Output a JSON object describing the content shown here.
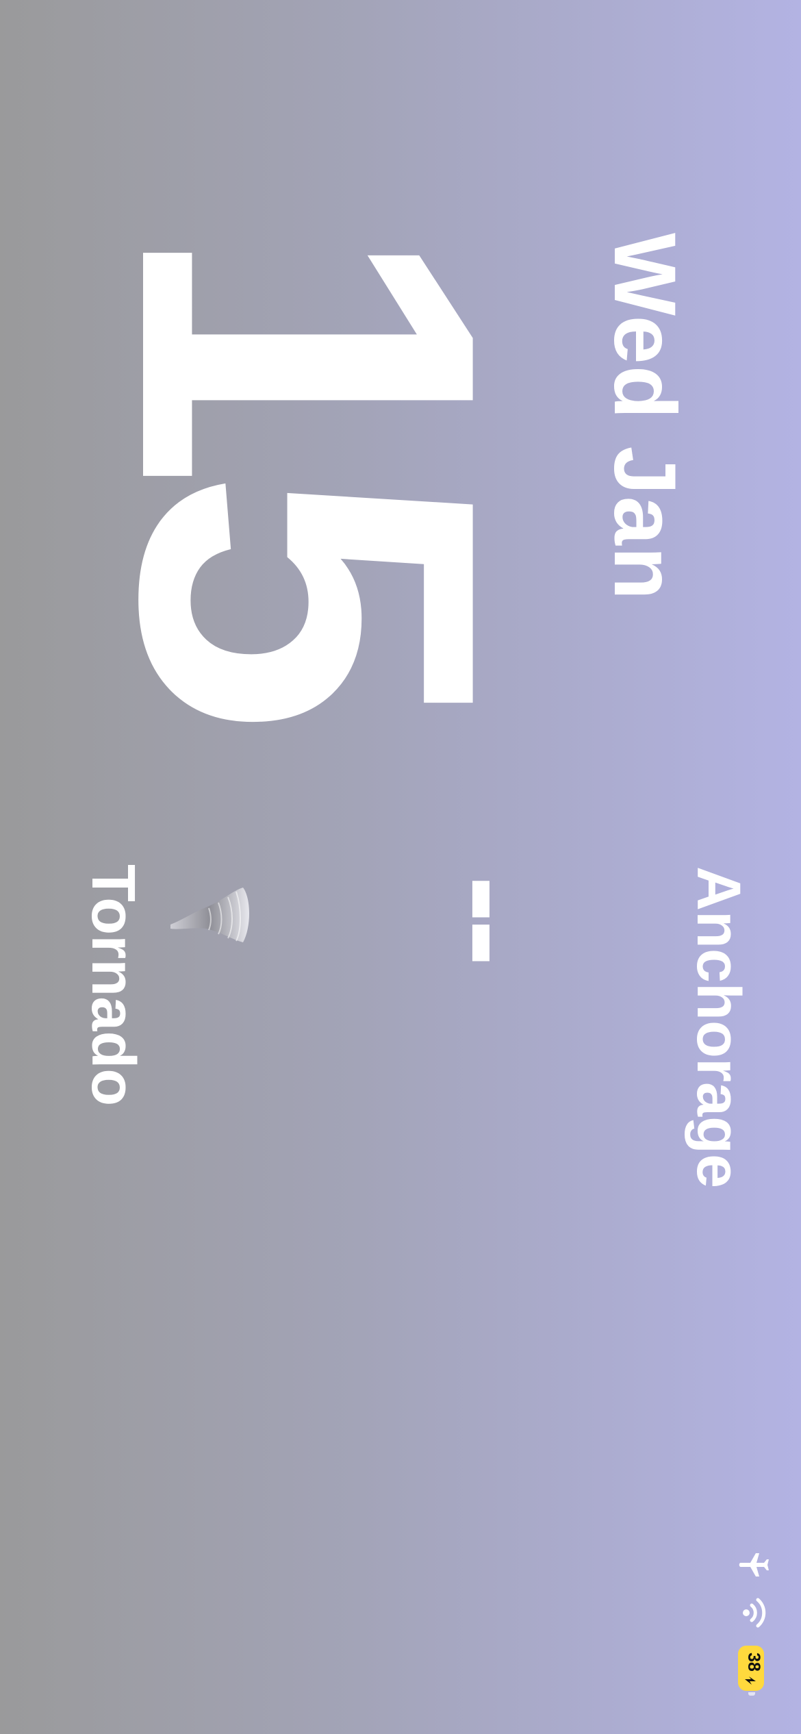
{
  "lock_screen": {
    "date_label": "Wed Jan",
    "day_number": "15",
    "city": "Anchorage",
    "temperature": "--",
    "condition": "Tornado",
    "condition_icon": "tornado-icon"
  },
  "status_bar": {
    "icons": [
      "airplane-icon",
      "wifi-icon",
      "battery-icon"
    ],
    "battery_level": "38",
    "battery_color": "#ffd93d",
    "charging": true
  },
  "colors": {
    "background_left": "#9a9a9b",
    "background_right": "#b3b3e3",
    "text": "#ffffff"
  }
}
